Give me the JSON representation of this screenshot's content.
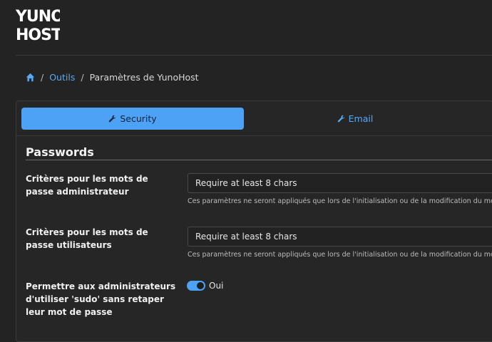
{
  "brand": {
    "logo_text": "YUNO HOST"
  },
  "breadcrumb": {
    "home_icon": "home-icon",
    "items": [
      {
        "label": "Outils"
      },
      {
        "label": "Paramètres de YunoHost"
      }
    ]
  },
  "tabs": [
    {
      "label": "Security",
      "icon": "wrench-icon",
      "active": true
    },
    {
      "label": "Email",
      "icon": "wrench-icon",
      "active": false
    }
  ],
  "section": {
    "title": "Passwords"
  },
  "settings": [
    {
      "label": "Critères pour les mots de passe administrateur",
      "value": "Require at least 8 chars",
      "help": "Ces paramètres ne seront appliqués que lors de l'initialisation ou de la modification du mo"
    },
    {
      "label": "Critères pour les mots de passe utilisateurs",
      "value": "Require at least 8 chars",
      "help": "Ces paramètres ne seront appliqués que lors de l'initialisation ou de la modification du mo"
    },
    {
      "label": "Permettre aux administrateurs d'utiliser 'sudo' sans retaper leur mot de passe",
      "toggle_on": true,
      "toggle_label": "Oui"
    }
  ],
  "colors": {
    "accent": "#4ea2f5",
    "link": "#5aa9f5",
    "background": "#232323"
  }
}
